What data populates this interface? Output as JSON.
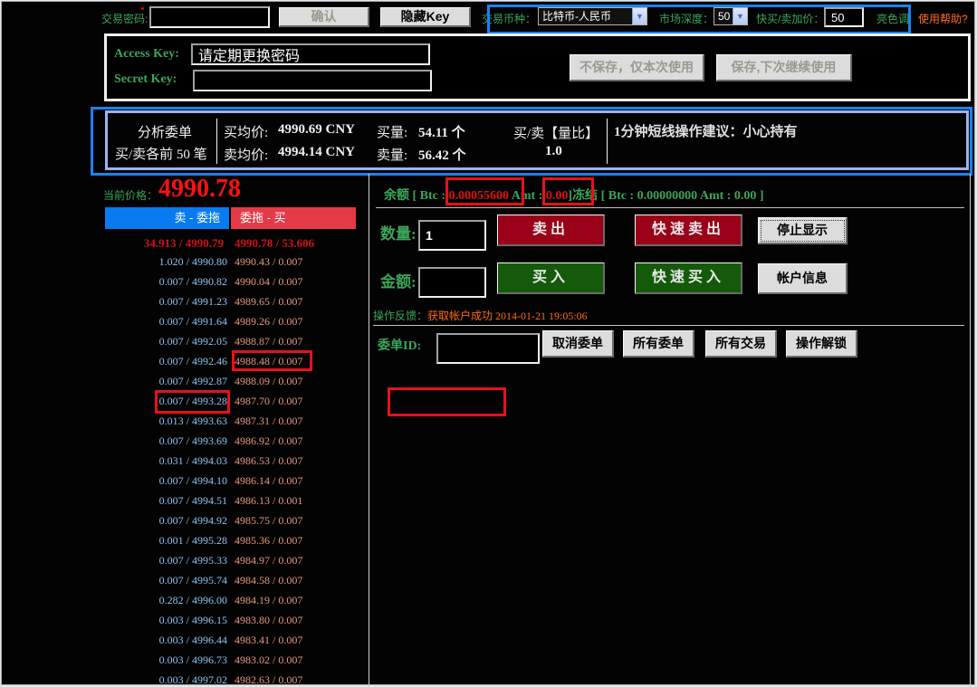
{
  "top_bar": {
    "password_label": "交易密码:",
    "password_value": "",
    "confirm_button": "确认",
    "hide_key_button": "隐藏Key",
    "currency_label": "交易币种：",
    "currency_selected": "比特币-人民币",
    "depth_label": "市场深度：",
    "depth_selected": "50",
    "quick_price_label": "快买/卖加价：",
    "quick_price_value": "50",
    "bright_theme_link": "亮色调",
    "help_link": "使用帮助?"
  },
  "keys_panel": {
    "access_key_label": "Access Key:",
    "access_key_value": "请定期更换密码",
    "secret_key_label": "Secret  Key:",
    "secret_key_value": "",
    "no_save_button": "不保存，仅本次使用",
    "save_button": "保存,下次继续使用"
  },
  "analysis": {
    "title": "分析委单",
    "subtitle": "买/卖各前 50 笔",
    "buy_avg_label": "买均价:",
    "buy_avg_value": "4990.69 CNY",
    "sell_avg_label": "卖均价:",
    "sell_avg_value": "4994.14 CNY",
    "buy_vol_label": "买量:",
    "buy_vol_value": "54.11 个",
    "sell_vol_label": "卖量:",
    "sell_vol_value": "56.42 个",
    "ratio_label": "买/卖【量比】",
    "ratio_value": "1.0",
    "advice": "1分钟短线操作建议：小心持有"
  },
  "price": {
    "label": "当前价格：",
    "value": "4990.78"
  },
  "order_book": {
    "sell_tab": "卖 - 委拖",
    "buy_tab": "委拖 - 买",
    "top_ask": "34.913 / 4990.79",
    "top_bid": "4990.78 / 53.606",
    "rows": [
      {
        "ask": "1.020 / 4990.80",
        "bid": "4990.43 / 0.007"
      },
      {
        "ask": "0.007 / 4990.82",
        "bid": "4990.04 / 0.007"
      },
      {
        "ask": "0.007 / 4991.23",
        "bid": "4989.65 / 0.007"
      },
      {
        "ask": "0.007 / 4991.64",
        "bid": "4989.26 / 0.007"
      },
      {
        "ask": "0.007 / 4992.05",
        "bid": "4988.87 / 0.007"
      },
      {
        "ask": "0.007 / 4992.46",
        "bid": "4988.48 / 0.007"
      },
      {
        "ask": "0.007 / 4992.87",
        "bid": "4988.09 / 0.007"
      },
      {
        "ask": "0.007 / 4993.28",
        "bid": "4987.70 / 0.007"
      },
      {
        "ask": "0.013 / 4993.63",
        "bid": "4987.31 / 0.007"
      },
      {
        "ask": "0.007 / 4993.69",
        "bid": "4986.92 / 0.007"
      },
      {
        "ask": "0.031 / 4994.03",
        "bid": "4986.53 / 0.007"
      },
      {
        "ask": "0.007 / 4994.10",
        "bid": "4986.14 / 0.007"
      },
      {
        "ask": "0.007 / 4994.51",
        "bid": "4986.13 / 0.001"
      },
      {
        "ask": "0.007 / 4994.92",
        "bid": "4985.75 / 0.007"
      },
      {
        "ask": "0.001 / 4995.28",
        "bid": "4985.36 / 0.007"
      },
      {
        "ask": "0.007 / 4995.33",
        "bid": "4984.97 / 0.007"
      },
      {
        "ask": "0.007 / 4995.74",
        "bid": "4984.58 / 0.007"
      },
      {
        "ask": "0.282 / 4996.00",
        "bid": "4984.19 / 0.007"
      },
      {
        "ask": "0.003 / 4996.15",
        "bid": "4983.80 / 0.007"
      },
      {
        "ask": "0.003 / 4996.44",
        "bid": "4983.41 / 0.007"
      },
      {
        "ask": "0.003 / 4996.73",
        "bid": "4983.02 / 0.007"
      },
      {
        "ask": "0.003 / 4997.02",
        "bid": "4982.63 / 0.007"
      }
    ]
  },
  "balance": {
    "label": "余额",
    "btc_prefix": "[ Btc :",
    "btc_value": "0.00055600",
    "amt_prefix": "Amt :",
    "amt_value": "0.00",
    "close_bracket": "]",
    "frozen_label": "冻结",
    "frozen_text": "[ Btc : 0.00000000 Amt : 0.00 ]"
  },
  "trade": {
    "quantity_label": "数量:",
    "quantity_value": "1",
    "amount_label": "金额:",
    "amount_value": "",
    "sell_button": "卖出",
    "quick_sell_button": "快速卖出",
    "buy_button": "买入",
    "quick_buy_button": "快速买入",
    "stop_display_button": "停止显示",
    "account_info_button": "帐户信息",
    "feedback_label": "操作反馈：",
    "feedback_text": "获取帐户成功 2014-01-21 19:05:06"
  },
  "orders": {
    "order_id_label": "委单ID:",
    "order_id_value": "",
    "cancel_button": "取消委单",
    "all_orders_button": "所有委单",
    "all_trades_button": "所有交易",
    "unlock_button": "操作解锁"
  },
  "colors": {
    "accent_blue": "#1a82f0",
    "highlight_red": "#e8101a",
    "label_green": "#3aa55a",
    "sell_red": "#9a0018",
    "buy_green": "#145a0a",
    "price_red": "#ff1010"
  }
}
